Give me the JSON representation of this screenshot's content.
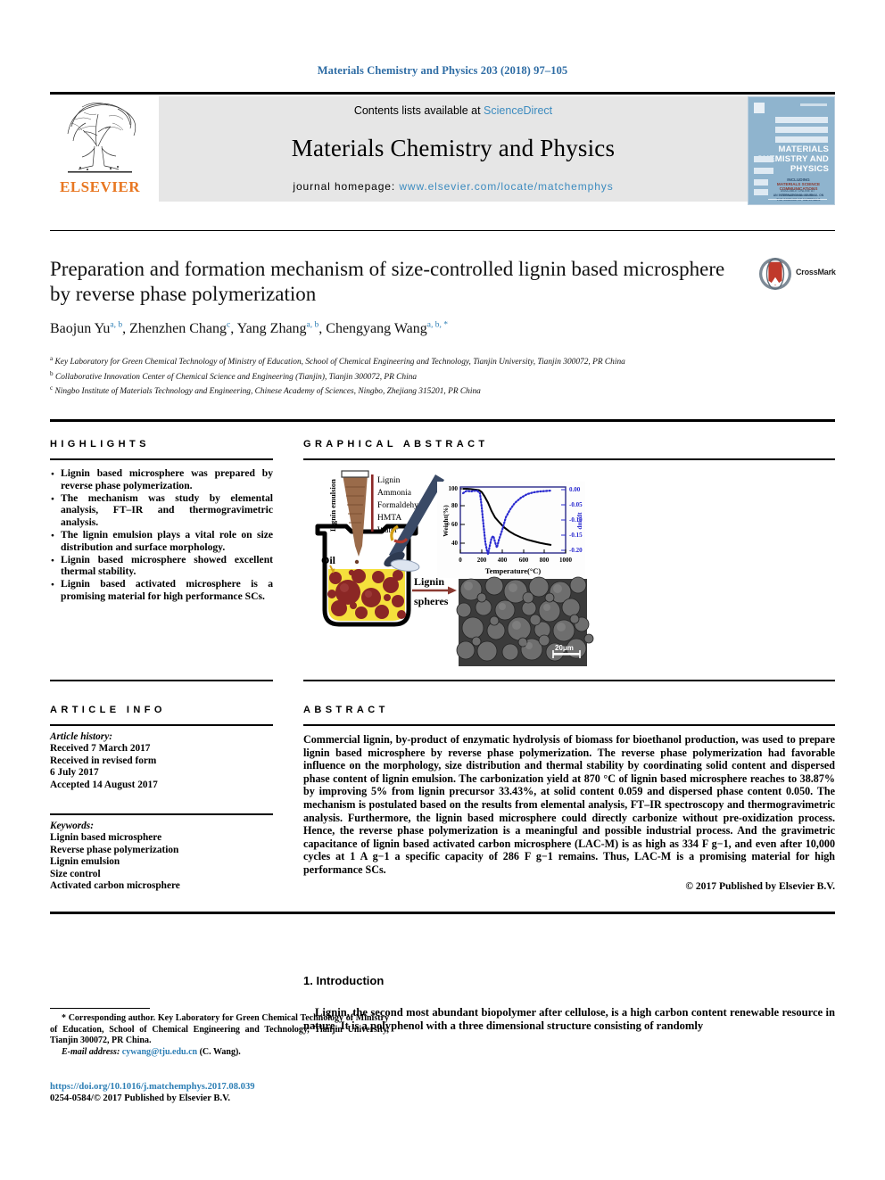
{
  "running_head": "Materials Chemistry and Physics 203 (2018) 97–105",
  "banner": {
    "publisher": "ELSEVIER",
    "contents_prefix": "Contents lists available at ",
    "contents_link": "ScienceDirect",
    "journal_title": "Materials Chemistry and Physics",
    "homepage_prefix": "journal homepage: ",
    "homepage_url": "www.elsevier.com/locate/matchemphys",
    "cover": {
      "line1": "MATERIALS",
      "line2": "CHEMISTRY AND",
      "line3": "PHYSICS",
      "sub1": "INCLUDING",
      "sub2": "MATERIALS SCIENCE",
      "sub3": "COMMUNICATIONS",
      "sub4": "AN INTERNATIONAL JOURNAL ON THE SCIENCE OF MATERIALS",
      "footer1": "AVAILABLE ONLINE AT",
      "footer2": "www.sciencedirect.com"
    }
  },
  "article": {
    "title": "Preparation and formation mechanism of size-controlled lignin based microsphere by reverse phase polymerization",
    "crossmark_label": "CrossMark",
    "authors": [
      {
        "name": "Baojun Yu",
        "marks": "a, b",
        "sep": ", "
      },
      {
        "name": "Zhenzhen Chang",
        "marks": "c",
        "sep": ", "
      },
      {
        "name": "Yang Zhang",
        "marks": "a, b",
        "sep": ", "
      },
      {
        "name": "Chengyang Wang",
        "marks": "a, b, *",
        "sep": ""
      }
    ],
    "affiliations": [
      {
        "mark": "a",
        "text": "Key Laboratory for Green Chemical Technology of Ministry of Education, School of Chemical Engineering and Technology, Tianjin University, Tianjin 300072, PR China"
      },
      {
        "mark": "b",
        "text": "Collaborative Innovation Center of Chemical Science and Engineering (Tianjin), Tianjin 300072, PR China"
      },
      {
        "mark": "c",
        "text": "Ningbo Institute of Materials Technology and Engineering, Chinese Academy of Sciences, Ningbo, Zhejiang 315201, PR China"
      }
    ]
  },
  "highlights": {
    "heading": "HIGHLIGHTS",
    "items": [
      "Lignin based microsphere was prepared by reverse phase polymerization.",
      "The mechanism was study by elemental analysis, FT–IR and thermogravimetric analysis.",
      "The lignin emulsion plays a vital role on size distribution and surface morphology.",
      "Lignin based microsphere showed excellent thermal stability.",
      "Lignin based activated microsphere is a promising material for high performance SCs."
    ]
  },
  "graphical_abstract": {
    "heading": "GRAPHICAL ABSTRACT",
    "labels": {
      "emulsion_vertical": "Lignin emulsion",
      "reagents": [
        "Lignin",
        "Ammonia",
        "Formaldehyde",
        "HMTA",
        "Water"
      ],
      "oil": "Oil",
      "arrow_label_line1": "Lignin",
      "arrow_label_line2": "spheres",
      "scale_bar": "20μm"
    },
    "chart_colors": {
      "tga_curve": "#000000",
      "dtg_curve": "#2a2ad0",
      "right_axis": "#2a2ad0"
    }
  },
  "chart_data": {
    "type": "line",
    "title": "",
    "xlabel": "Temperature(°C)",
    "ylabel": "Weight(%)",
    "y2label": "dm/dt",
    "xlim": [
      0,
      1000
    ],
    "ylim": [
      30,
      105
    ],
    "y2lim": [
      -0.225,
      0.01
    ],
    "xticks": [
      0,
      200,
      400,
      600,
      800,
      1000
    ],
    "xticklabels": [
      "0",
      "200",
      "400",
      "600",
      "800",
      "1000"
    ],
    "yticks": [
      40,
      60,
      80,
      100
    ],
    "yticklabels": [
      "40",
      "60",
      "80",
      "100"
    ],
    "y2ticks": [
      0.0,
      -0.05,
      -0.1,
      -0.15,
      -0.2
    ],
    "y2ticklabels": [
      "0.00",
      "-0.05",
      "-0.10",
      "-0.15",
      "-0.20"
    ],
    "grid": false,
    "legend": "none",
    "series": [
      {
        "name": "TGA weight loss",
        "axis": "left",
        "color": "#000000",
        "style": "solid",
        "x": [
          25,
          60,
          100,
          140,
          170,
          200,
          230,
          260,
          300,
          340,
          380,
          420,
          470,
          520,
          580,
          640,
          700,
          760,
          820,
          870
        ],
        "y": [
          100,
          100,
          99.6,
          99.2,
          98.6,
          96.5,
          92,
          85,
          76,
          69,
          63.5,
          58.5,
          54,
          50.5,
          47.5,
          45,
          43.2,
          41.6,
          40.2,
          39.2
        ]
      },
      {
        "name": "DTG derivative",
        "axis": "right",
        "color": "#2a2ad0",
        "style": "dotted",
        "x": [
          25,
          60,
          100,
          130,
          160,
          185,
          200,
          215,
          230,
          245,
          258,
          270,
          285,
          300,
          315,
          330,
          350,
          380,
          420,
          470,
          520,
          580,
          640,
          700,
          760,
          820,
          870
        ],
        "y": [
          -0.012,
          -0.004,
          -0.006,
          -0.004,
          -0.004,
          -0.012,
          -0.06,
          -0.12,
          -0.175,
          -0.205,
          -0.215,
          -0.188,
          -0.162,
          -0.155,
          -0.175,
          -0.195,
          -0.17,
          -0.135,
          -0.105,
          -0.078,
          -0.058,
          -0.042,
          -0.03,
          -0.022,
          -0.017,
          -0.015,
          -0.014
        ]
      }
    ]
  },
  "article_info": {
    "heading": "ARTICLE INFO",
    "history_label": "Article history:",
    "history": [
      "Received 7 March 2017",
      "Received in revised form",
      "6 July 2017",
      "Accepted 14 August 2017"
    ],
    "keywords_label": "Keywords:",
    "keywords": [
      "Lignin based microsphere",
      "Reverse phase polymerization",
      "Lignin emulsion",
      "Size control",
      "Activated carbon microsphere"
    ]
  },
  "abstract": {
    "heading": "ABSTRACT",
    "text": "Commercial lignin, by-product of enzymatic hydrolysis of biomass for bioethanol production, was used to prepare lignin based microsphere by reverse phase polymerization. The reverse phase polymerization had favorable influence on the morphology, size distribution and thermal stability by coordinating solid content and dispersed phase content of lignin emulsion. The carbonization yield at 870 °C of lignin based microsphere reaches to 38.87% by improving 5% from lignin precursor 33.43%, at solid content 0.059 and dispersed phase content 0.050. The mechanism is postulated based on the results from elemental analysis, FT–IR spectroscopy and thermogravimetric analysis. Furthermore, the lignin based microsphere could directly carbonize without pre-oxidization process. Hence, the reverse phase polymerization is a meaningful and possible industrial process. And the gravimetric capacitance of lignin based activated carbon microsphere (LAC-M) is as high as 334 F g−1, and even after 10,000 cycles at 1 A g−1 a specific capacity of 286 F g−1 remains. Thus, LAC-M is a promising material for high performance SCs.",
    "copyright": "© 2017 Published by Elsevier B.V."
  },
  "introduction": {
    "number_and_title": "1. Introduction",
    "paragraph": "Lignin, the second most abundant biopolymer after cellulose, is a high carbon content renewable resource in nature. It is a polyphenol with a three dimensional structure consisting of randomly"
  },
  "footnote": {
    "corresponding": "* Corresponding author. Key Laboratory for Green Chemical Technology of Ministry of Education, School of Chemical Engineering and Technology, Tianjin University, Tianjin 300072, PR China.",
    "email_label": "E-mail address:",
    "email": "cywang@tju.edu.cn",
    "email_suffix": "(C. Wang).",
    "doi": "https://doi.org/10.1016/j.matchemphys.2017.08.039",
    "issn_line": "0254-0584/© 2017 Published by Elsevier B.V."
  }
}
